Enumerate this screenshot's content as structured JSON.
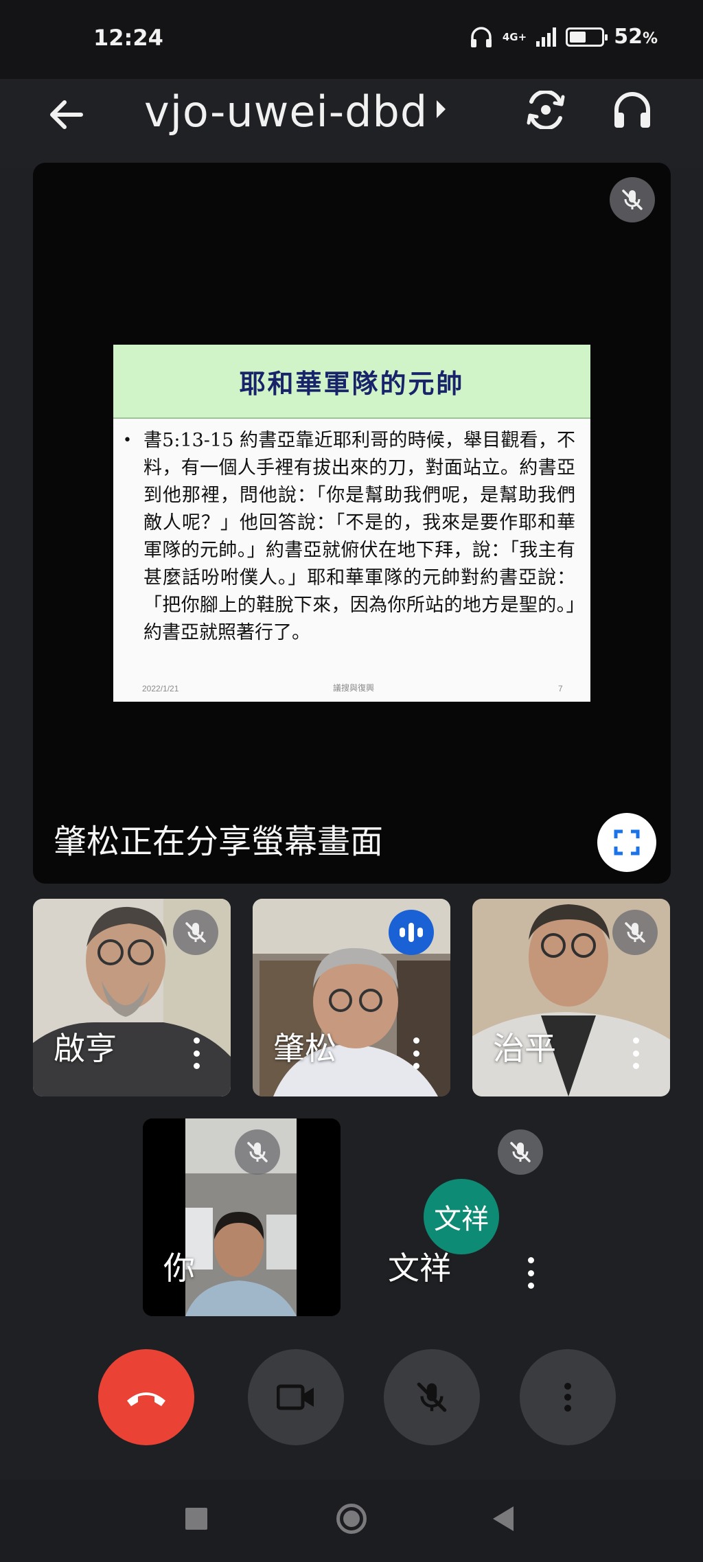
{
  "status_bar": {
    "time": "12:24",
    "network": "4G+",
    "battery_percent": "52",
    "battery_symbol": "%",
    "battery_level": 0.52,
    "icons": [
      "headphones-icon",
      "signal-icon",
      "battery-icon"
    ]
  },
  "header": {
    "meeting_code": "vjo-uwei-dbd",
    "icons": [
      "back-arrow-icon",
      "caret-right-icon",
      "switch-camera-icon",
      "headphones-audio-icon"
    ]
  },
  "presentation": {
    "share_label": "肇松正在分享螢幕畫面",
    "slide": {
      "title": "耶和華軍隊的元帥",
      "bullet": "•",
      "body": "書5:13-15 約書亞靠近耶利哥的時候，舉目觀看，不料，有一個人手裡有拔出來的刀，對面站立。約書亞到他那裡，問他說：「你是幫助我們呢，是幫助我們敵人呢？」他回答說：「不是的，我來是要作耶和華軍隊的元帥。」約書亞就俯伏在地下拜，說：「我主有甚麼話吩咐僕人。」耶和華軍隊的元帥對約書亞說：「把你腳上的鞋脫下來，因為你所站的地方是聖的。」約書亞就照著行了。",
      "footer_date": "2022/1/21",
      "footer_center": "議搜與復興",
      "footer_page": "7"
    },
    "icons": [
      "mic-off-icon",
      "fullscreen-icon"
    ]
  },
  "participants": [
    {
      "name": "啟亨",
      "muted": true,
      "speaking": false
    },
    {
      "name": "肇松",
      "muted": false,
      "speaking": true
    },
    {
      "name": "治平",
      "muted": true,
      "speaking": false
    }
  ],
  "self_tile": {
    "name": "你",
    "muted": true
  },
  "audio_tile": {
    "name": "文祥",
    "avatar_text": "文祥",
    "muted": true,
    "avatar_color": "#0e8b74"
  },
  "controls": {
    "icons": [
      "end-call-icon",
      "camera-icon",
      "mic-off-icon",
      "more-options-icon"
    ],
    "end_call_color": "#ea4335"
  },
  "nav_bar": {
    "icons": [
      "recents-icon",
      "home-icon",
      "back-icon"
    ]
  }
}
